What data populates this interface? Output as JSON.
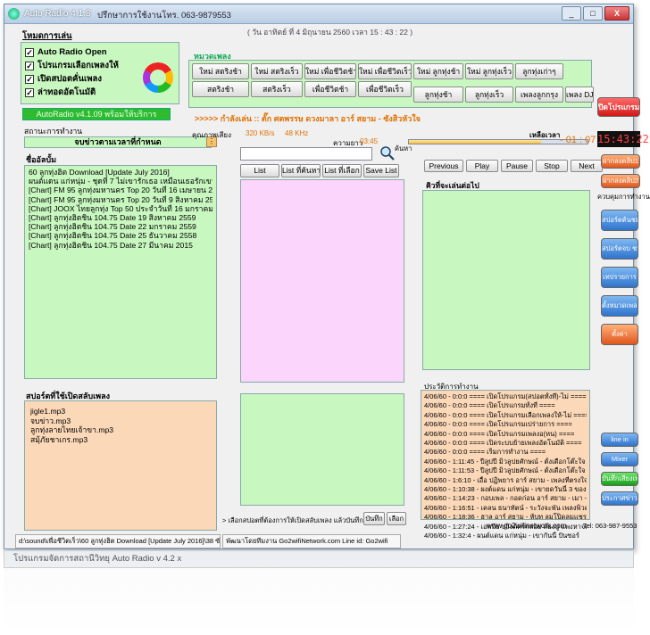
{
  "title": "Auto Radio 4.1.8",
  "title_sub": "ปรึกษาการใช้งานโทร. 063-9879553",
  "datetime_display": "( วัน อาทิตย์ ที่ 4 มิถุนายน 2560  เวลา 15 : 43 : 22 )",
  "win_controls": {
    "minimize": "_",
    "maximize": "□",
    "close": "X"
  },
  "options": {
    "heading": "โหมดการเล่น",
    "items": [
      "Auto Radio Open",
      "โปรแกรมเลือกเพลงให้",
      "เปิดสปอตคั่นเพลง",
      "ล่าทอดอัตโนมัติ"
    ],
    "checked": [
      true,
      true,
      true,
      true
    ],
    "check_mark": "✓"
  },
  "version_banner": "AutoRadio v4.1.09 พร้อมให้บริการ",
  "status_heading": "สถานะการทำงาน",
  "status_value": "จบข่าวตามเวลาที่กำหนด",
  "album_heading": "ชื่ออัลบั้ม",
  "albums": [
    "60 ลูกทุ่งฮิต Download [Update July 2016]",
    "ผนต์แดน แก่หนุ่ม - ชุดที่ 7 ไม่เขารักเธอ เหมือนเธอรักเขา",
    "[Chart] FM 95 ลูกทุ่งมหานคร Top 20 วันที่ 16 เมษายน 2559",
    "[Chart] FM 95 ลูกทุ่งมหานคร Top 20 วันที่ 9 สิงหาคม 2559",
    "[Chart] JOOX ไทยลูกทุ่ง Top 50 ประจำวันที่ 16 มกราคม 2560",
    "[Chart] ลูกทุ่งฮิตชิน 104.75 Date 19 สิงหาคม 2559",
    "[Chart] ลูกทุ่งฮิตชิน 104.75 Date 22 มกราคม 2559",
    "[Chart] ลูกทุ่งฮิตชิน 104.75 Date 25 ธันวาคม 2558",
    "[Chart] ลูกทุ่งฮิตชิน 104.75 Date 27 มีนาคม 2015"
  ],
  "song_group_heading": "หมวดเพลง",
  "song_groups_row1": [
    "ใหม่ สตริงช้า",
    "ใหม่ สตริงเร็ว",
    "ใหม่ เพื่อชีวิตช้า",
    "ใหม่ เพื่อชีวิตเร็ว",
    "ใหม่ ลูกทุ่งช้า",
    "ใหม่ ลูกทุ่งเร็ว",
    "ลูกทุ่งเก่าๆ"
  ],
  "song_groups_row2": [
    "สตริงช้า",
    "สตริงเร็ว",
    "เพื่อชีวิตช้า",
    "เพื่อชีวิตเร็ว",
    "ลูกทุ่งช้า",
    "ลูกทุ่งเร็ว",
    "เพลงลูกกรุง",
    "เพลง DJ"
  ],
  "now_playing": ">>>>> กำลังเล่น :: ตั๊ก ศตพรรษ ดวงมาลา อาร์ สยาม - ซังสิวหัวใจ",
  "quality_label": "คุณภาพเสียง",
  "bitrate": "320 KB/s",
  "samplerate": "48 KHz",
  "length_label": "ความยาว",
  "length_value": "03:45",
  "remain_label": "เหลือเวลา",
  "remain_value": "- 01 : 07",
  "progress_percent": 0.74,
  "search_label": "ค้นหา",
  "search_value": "",
  "list_tabs": [
    "List",
    "List ที่ค้นหา",
    "List ที่เลือก",
    "Save List"
  ],
  "player_buttons": [
    "Previous",
    "Play",
    "Pause",
    "Stop",
    "Next"
  ],
  "queue_heading": "คิวที่จะเล่นต่อไป",
  "spot_heading": "สปอร์ตที่ใช้เปิดสลับเพลง",
  "spots": [
    "jigle1.mp3",
    "จบข่าว.mp3",
    "ลูกทุ่งลายไทยเจ้าขา.mp3",
    "สมุ้ภัยชาเกร.mp3"
  ],
  "spot_select_text": "> เลือกสปอตที่ต้องการให้เปิดสลับเพลง แล้วบันทึก",
  "save_label": "บันทึก",
  "pick_label": "เลือก",
  "history_heading": "ประวัติการทำงาน",
  "history": [
    "4/06/60 - 0:0:0 ==== เปิดโปรแกรม(สปอตทั้งที่)-ไม่ ====",
    "4/06/60 - 0:0:0 ==== เปิดโปรแกรมทั้งที่ ====",
    "4/06/60 - 0:0:0 ==== เปิดโปรแกรมเลือกเพลงให้-ไม่ ====",
    "4/06/60 - 0:0:0 ==== เปิดโปรแกรมเปร่ายการ ====",
    "4/06/60 - 0:0:0 ==== เปิดโปรแกรมเพลงอ(หน) ====",
    "4/06/60 - 0:0:0 ==== เปิดระบบย้ายเพลงอัตโนมัติ ====",
    "4/06/60 - 0:0:0 ==== เริ่มการทำงาน ====",
    "4/06/60 - 1:11:45 - ปีลูปปี มิวลูปยศักษณ์ - ตั้งเดือกโต๊ะใจ - 04",
    "4/06/60 - 1:11:53 - ปีลูปปี มิวลูปยศักษณ์ - ตั้งเดือกโต๊ะใจ - 04",
    "4/06/60 - 1:6:10 - เอื้อ ปฏิพยาร อาร์ สยาม - เพลงที่ตรงใจอีกที",
    "4/06/60 - 1:10:38 - ผงต์แดน แก่หนุ่ม - เขายดวันนี้ 3 ของขาย",
    "4/06/60 - 1:14:23 - กอบเพล - กอดก่อน อาร์ สยาม - เมา - 04:20",
    "4/06/60 - 1:16:51 - เคลน ธนาทัตน์ - ระวังจะพัน เพลงพิวคร [My",
    "4/06/60 - 1:18:36 - ฮาล อาร์ สยาม - ห้บท ลมโปิดลมแชรย [My",
    "4/06/60 - 1:27:24 - เอพบีย บวิงต์ครกลอย ห้องปู แพงหาจอมแรา",
    "4/06/60 - 1:32:4 - ผนต์แดน แก่หนุ่ม - เขากันนี้ ปันซอร์"
  ],
  "clock": "15:43:22",
  "exit_button": "ปิดโปรแกรม",
  "side_links": [
    "ฝากลงคลิป1",
    "ฝากลงคลิป2"
  ],
  "control_heading": "ควบคุมการทำงาน",
  "side_buttons": [
    "สปอร์ตต้นชม",
    "สปอร์ตจบ ชม",
    "เทปรายการ",
    "ตั้งหมวดเพลง",
    "ตั้งค่า"
  ],
  "lower_buttons": [
    "line in",
    "Mixer",
    "บันทึกเสียงเพลง",
    "ประกาศข่าวสั้น"
  ],
  "website": "www.go2wifinetwork.com",
  "phone": "Tel: 063-987-9553",
  "status_path": "d:\\sound\\เพื่อชีวิตเร็ว\\60 ลูกทุ่งฮิต Download [Update July 2016]\\38 ซังสิวหัวใจ - ตั๊ก ศตพรรษ ดวงมาลา อาร์ สยาม.mp3",
  "status_dev": "พัฒนาโดยทีมงาน Go2wifiNetwork.com   Line id: Go2wifi",
  "taskbar_title": "โปรแกรมจัดการสถานีวิทยุ Auto Radio v 4.2 x",
  "colors": {
    "panel_green": "#c8f7c0",
    "panel_pink": "#fbd5fb",
    "panel_peach": "#fbd8b8",
    "banner": "#2ebc2e",
    "now_playing": "#e07000",
    "clock_bg": "#111111",
    "clock_fg": "#ff4040"
  }
}
